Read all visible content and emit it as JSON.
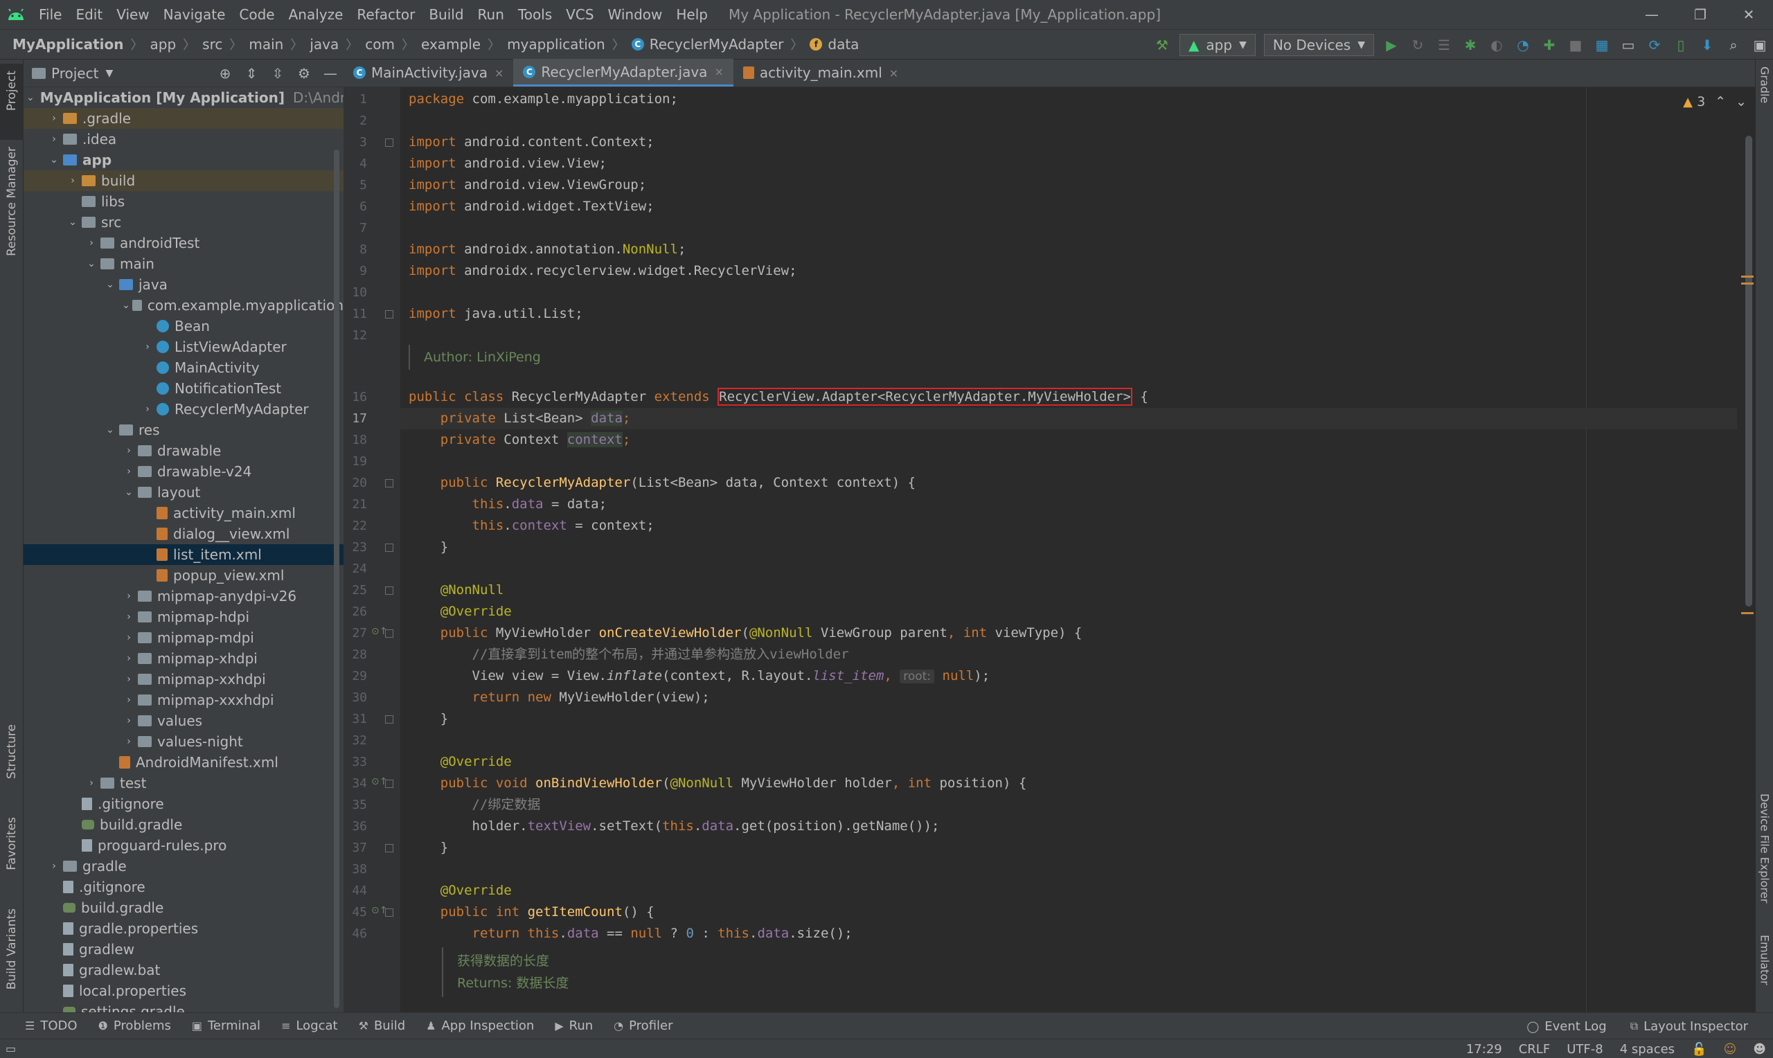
{
  "window": {
    "menu": [
      "File",
      "Edit",
      "View",
      "Navigate",
      "Code",
      "Analyze",
      "Refactor",
      "Build",
      "Run",
      "Tools",
      "VCS",
      "Window",
      "Help"
    ],
    "title": "My Application - RecyclerMyAdapter.java [My_Application.app]",
    "min": "—",
    "max": "❐",
    "close": "✕"
  },
  "nav": {
    "crumbs": [
      "MyApplication",
      "app",
      "src",
      "main",
      "java",
      "com",
      "example",
      "myapplication",
      "RecyclerMyAdapter",
      "data"
    ],
    "run_config": "app",
    "device": "No Devices"
  },
  "left_stripe": {
    "project": "Project",
    "resource_manager": "Resource Manager",
    "structure": "Structure",
    "favorites": "Favorites",
    "build_variants": "Build Variants"
  },
  "right_stripe": {
    "gradle": "Gradle",
    "device_file_explorer": "Device File Explorer",
    "emulator": "Emulator"
  },
  "project_panel": {
    "title": "Project",
    "tree": [
      {
        "depth": 0,
        "arrow": "down",
        "icon": "folder-blue",
        "label": "MyApplication [My Application]",
        "dim": "D:\\AndroidDe",
        "bold": true
      },
      {
        "depth": 1,
        "arrow": "right",
        "icon": "folder-orange",
        "label": ".gradle",
        "state": "excluded"
      },
      {
        "depth": 1,
        "arrow": "right",
        "icon": "folder",
        "label": ".idea"
      },
      {
        "depth": 1,
        "arrow": "down",
        "icon": "folder-blue",
        "label": "app",
        "bold": true
      },
      {
        "depth": 2,
        "arrow": "right",
        "icon": "folder-orange",
        "label": "build",
        "state": "excluded"
      },
      {
        "depth": 2,
        "arrow": "none",
        "icon": "folder",
        "label": "libs"
      },
      {
        "depth": 2,
        "arrow": "down",
        "icon": "folder",
        "label": "src"
      },
      {
        "depth": 3,
        "arrow": "right",
        "icon": "folder",
        "label": "androidTest"
      },
      {
        "depth": 3,
        "arrow": "down",
        "icon": "folder",
        "label": "main"
      },
      {
        "depth": 4,
        "arrow": "down",
        "icon": "folder-blue",
        "label": "java"
      },
      {
        "depth": 5,
        "arrow": "down",
        "icon": "folder",
        "label": "com.example.myapplication"
      },
      {
        "depth": 6,
        "arrow": "none",
        "icon": "class",
        "label": "Bean"
      },
      {
        "depth": 6,
        "arrow": "right",
        "icon": "class",
        "label": "ListViewAdapter"
      },
      {
        "depth": 6,
        "arrow": "none",
        "icon": "class",
        "label": "MainActivity"
      },
      {
        "depth": 6,
        "arrow": "none",
        "icon": "class",
        "label": "NotificationTest"
      },
      {
        "depth": 6,
        "arrow": "right",
        "icon": "class",
        "label": "RecyclerMyAdapter"
      },
      {
        "depth": 4,
        "arrow": "down",
        "icon": "folder",
        "label": "res"
      },
      {
        "depth": 5,
        "arrow": "right",
        "icon": "folder",
        "label": "drawable"
      },
      {
        "depth": 5,
        "arrow": "right",
        "icon": "folder",
        "label": "drawable-v24"
      },
      {
        "depth": 5,
        "arrow": "down",
        "icon": "folder",
        "label": "layout"
      },
      {
        "depth": 6,
        "arrow": "none",
        "icon": "xml",
        "label": "activity_main.xml"
      },
      {
        "depth": 6,
        "arrow": "none",
        "icon": "xml",
        "label": "dialog__view.xml"
      },
      {
        "depth": 6,
        "arrow": "none",
        "icon": "xml",
        "label": "list_item.xml",
        "state": "selected"
      },
      {
        "depth": 6,
        "arrow": "none",
        "icon": "xml",
        "label": "popup_view.xml"
      },
      {
        "depth": 5,
        "arrow": "right",
        "icon": "folder",
        "label": "mipmap-anydpi-v26"
      },
      {
        "depth": 5,
        "arrow": "right",
        "icon": "folder",
        "label": "mipmap-hdpi"
      },
      {
        "depth": 5,
        "arrow": "right",
        "icon": "folder",
        "label": "mipmap-mdpi"
      },
      {
        "depth": 5,
        "arrow": "right",
        "icon": "folder",
        "label": "mipmap-xhdpi"
      },
      {
        "depth": 5,
        "arrow": "right",
        "icon": "folder",
        "label": "mipmap-xxhdpi"
      },
      {
        "depth": 5,
        "arrow": "right",
        "icon": "folder",
        "label": "mipmap-xxxhdpi"
      },
      {
        "depth": 5,
        "arrow": "right",
        "icon": "folder",
        "label": "values"
      },
      {
        "depth": 5,
        "arrow": "right",
        "icon": "folder",
        "label": "values-night"
      },
      {
        "depth": 4,
        "arrow": "none",
        "icon": "xml",
        "label": "AndroidManifest.xml"
      },
      {
        "depth": 3,
        "arrow": "right",
        "icon": "folder",
        "label": "test"
      },
      {
        "depth": 2,
        "arrow": "none",
        "icon": "file",
        "label": ".gitignore"
      },
      {
        "depth": 2,
        "arrow": "none",
        "icon": "gradle",
        "label": "build.gradle"
      },
      {
        "depth": 2,
        "arrow": "none",
        "icon": "file",
        "label": "proguard-rules.pro"
      },
      {
        "depth": 1,
        "arrow": "right",
        "icon": "folder",
        "label": "gradle"
      },
      {
        "depth": 1,
        "arrow": "none",
        "icon": "file",
        "label": ".gitignore"
      },
      {
        "depth": 1,
        "arrow": "none",
        "icon": "gradle",
        "label": "build.gradle"
      },
      {
        "depth": 1,
        "arrow": "none",
        "icon": "file",
        "label": "gradle.properties"
      },
      {
        "depth": 1,
        "arrow": "none",
        "icon": "file",
        "label": "gradlew"
      },
      {
        "depth": 1,
        "arrow": "none",
        "icon": "file",
        "label": "gradlew.bat"
      },
      {
        "depth": 1,
        "arrow": "none",
        "icon": "file",
        "label": "local.properties"
      },
      {
        "depth": 1,
        "arrow": "none",
        "icon": "gradle",
        "label": "settings.gradle"
      }
    ]
  },
  "editor": {
    "tabs": [
      {
        "label": "MainActivity.java",
        "icon": "class",
        "active": false
      },
      {
        "label": "RecyclerMyAdapter.java",
        "icon": "class",
        "active": true
      },
      {
        "label": "activity_main.xml",
        "icon": "xml",
        "active": false
      }
    ],
    "warnings": "3",
    "current_line": "17",
    "lines": [
      {
        "n": "1",
        "segs": [
          [
            "kw",
            "package "
          ],
          [
            "",
            "com.example.myapplication;"
          ]
        ]
      },
      {
        "n": "2",
        "segs": []
      },
      {
        "n": "3",
        "segs": [
          [
            "kw",
            "import "
          ],
          [
            "",
            "android.content.Context;"
          ]
        ],
        "fold": true
      },
      {
        "n": "4",
        "segs": [
          [
            "kw",
            "import "
          ],
          [
            "",
            "android.view.View;"
          ]
        ]
      },
      {
        "n": "5",
        "segs": [
          [
            "kw",
            "import "
          ],
          [
            "",
            "android.view.ViewGroup;"
          ]
        ]
      },
      {
        "n": "6",
        "segs": [
          [
            "kw",
            "import "
          ],
          [
            "",
            "android.widget.TextView;"
          ]
        ]
      },
      {
        "n": "7",
        "segs": []
      },
      {
        "n": "8",
        "segs": [
          [
            "kw",
            "import "
          ],
          [
            "",
            "androidx.annotation."
          ],
          [
            "ann",
            "NonNull"
          ],
          [
            "",
            ";"
          ]
        ]
      },
      {
        "n": "9",
        "segs": [
          [
            "kw",
            "import "
          ],
          [
            "",
            "androidx.recyclerview.widget.RecyclerView;"
          ]
        ]
      },
      {
        "n": "10",
        "segs": []
      },
      {
        "n": "11",
        "segs": [
          [
            "kw",
            "import "
          ],
          [
            "",
            "java.util.List;"
          ]
        ],
        "fold": true
      },
      {
        "n": "12",
        "segs": []
      },
      {
        "n": "16",
        "segs": [
          [
            "kw",
            "public class "
          ],
          [
            "",
            "RecyclerMyAdapter "
          ],
          [
            "kw",
            "extends "
          ],
          [
            "redbox",
            "RecyclerView.Adapter<RecyclerMyAdapter.MyViewHolder>"
          ],
          [
            "",
            " {"
          ]
        ]
      },
      {
        "n": "17",
        "segs": [
          [
            "",
            "    "
          ],
          [
            "kw",
            "private "
          ],
          [
            "",
            "List<Bean> "
          ],
          [
            "fld hl",
            "data"
          ],
          [
            "kw",
            ";"
          ]
        ]
      },
      {
        "n": "18",
        "segs": [
          [
            "",
            "    "
          ],
          [
            "kw",
            "private "
          ],
          [
            "",
            "Context "
          ],
          [
            "fld hl",
            "context"
          ],
          [
            "kw",
            ";"
          ]
        ]
      },
      {
        "n": "19",
        "segs": []
      },
      {
        "n": "20",
        "segs": [
          [
            "",
            "    "
          ],
          [
            "kw",
            "public "
          ],
          [
            "fn",
            "RecyclerMyAdapter"
          ],
          [
            "",
            "(List<Bean> data, Context context) {"
          ]
        ],
        "fold": true
      },
      {
        "n": "21",
        "segs": [
          [
            "",
            "        "
          ],
          [
            "kw",
            "this"
          ],
          [
            "",
            ".",
            ""
          ],
          [
            "fld",
            "data"
          ],
          [
            "",
            " = data;"
          ]
        ]
      },
      {
        "n": "22",
        "segs": [
          [
            "",
            "        "
          ],
          [
            "kw",
            "this"
          ],
          [
            "",
            "."
          ],
          [
            "fld",
            "context"
          ],
          [
            "",
            " = context;"
          ]
        ]
      },
      {
        "n": "23",
        "segs": [
          [
            "",
            "    }"
          ]
        ],
        "fold": true
      },
      {
        "n": "24",
        "segs": []
      },
      {
        "n": "25",
        "segs": [
          [
            "",
            "    "
          ],
          [
            "ann",
            "@NonNull"
          ]
        ],
        "fold": true
      },
      {
        "n": "26",
        "segs": [
          [
            "",
            "    "
          ],
          [
            "ann",
            "@Override"
          ]
        ]
      },
      {
        "n": "27",
        "segs": [
          [
            "",
            "    "
          ],
          [
            "kw",
            "public "
          ],
          [
            "",
            "MyViewHolder "
          ],
          [
            "fn",
            "onCreateViewHolder"
          ],
          [
            "",
            "("
          ],
          [
            "ann",
            "@NonNull "
          ],
          [
            "",
            "ViewGroup parent"
          ],
          [
            "kw",
            ", int "
          ],
          [
            "",
            "viewType) {"
          ]
        ],
        "fold": true,
        "mark": true
      },
      {
        "n": "28",
        "segs": [
          [
            "",
            "        "
          ],
          [
            "cmt",
            "//直接拿到item的整个布局，并通过单参构造放入viewHolder"
          ]
        ]
      },
      {
        "n": "29",
        "segs": [
          [
            "",
            "        View view = View."
          ],
          [
            "ital",
            "inflate"
          ],
          [
            "",
            "(context, R.layout."
          ],
          [
            "fld ital",
            "list_item"
          ],
          [
            "kw",
            ", "
          ],
          [
            "hint",
            "root:"
          ],
          [
            "",
            " "
          ],
          [
            "kw",
            "null"
          ],
          [
            "",
            ");"
          ]
        ]
      },
      {
        "n": "30",
        "segs": [
          [
            "",
            "        "
          ],
          [
            "kw",
            "return new "
          ],
          [
            "",
            "MyViewHolder(view);"
          ]
        ]
      },
      {
        "n": "31",
        "segs": [
          [
            "",
            "    }"
          ]
        ],
        "fold": true
      },
      {
        "n": "32",
        "segs": []
      },
      {
        "n": "33",
        "segs": [
          [
            "",
            "    "
          ],
          [
            "ann",
            "@Override"
          ]
        ]
      },
      {
        "n": "34",
        "segs": [
          [
            "",
            "    "
          ],
          [
            "kw",
            "public void "
          ],
          [
            "fn",
            "onBindViewHolder"
          ],
          [
            "",
            "("
          ],
          [
            "ann",
            "@NonNull "
          ],
          [
            "",
            "MyViewHolder holder"
          ],
          [
            "kw",
            ", int "
          ],
          [
            "",
            "position) {"
          ]
        ],
        "fold": true,
        "mark": true
      },
      {
        "n": "35",
        "segs": [
          [
            "",
            "        "
          ],
          [
            "cmt",
            "//绑定数据"
          ]
        ]
      },
      {
        "n": "36",
        "segs": [
          [
            "",
            "        holder."
          ],
          [
            "fld",
            "textView"
          ],
          [
            "",
            ".setText("
          ],
          [
            "kw",
            "this"
          ],
          [
            "",
            "."
          ],
          [
            "fld",
            "data"
          ],
          [
            "",
            ".get(position).getName());"
          ]
        ]
      },
      {
        "n": "37",
        "segs": [
          [
            "",
            "    }"
          ]
        ],
        "fold": true
      },
      {
        "n": "38",
        "segs": []
      },
      {
        "n": "44",
        "segs": [
          [
            "",
            "    "
          ],
          [
            "ann",
            "@Override"
          ]
        ]
      },
      {
        "n": "45",
        "segs": [
          [
            "",
            "    "
          ],
          [
            "kw",
            "public int "
          ],
          [
            "fn",
            "getItemCount"
          ],
          [
            "",
            "() {"
          ]
        ],
        "fold": true,
        "mark": true
      },
      {
        "n": "46",
        "segs": [
          [
            "",
            "        "
          ],
          [
            "kw",
            "return this"
          ],
          [
            "",
            "."
          ],
          [
            "fld",
            "data "
          ],
          [
            "",
            ""
          ],
          [
            "",
            "== "
          ],
          [
            "kw",
            "null "
          ],
          [
            "",
            "? "
          ],
          [
            "num",
            "0 "
          ],
          [
            "",
            ": "
          ],
          [
            "kw",
            "this"
          ],
          [
            "",
            "."
          ],
          [
            "fld",
            "data"
          ],
          [
            "",
            ".size();"
          ]
        ]
      }
    ],
    "doc_author": "Author: LinXiPeng",
    "doc_len_title": "获得数据的长度",
    "doc_len_returns": "Returns: 数据长度"
  },
  "bottom_tabs": [
    {
      "label": "TODO",
      "icon": "☰"
    },
    {
      "label": "Problems",
      "icon": "❶"
    },
    {
      "label": "Terminal",
      "icon": "▣"
    },
    {
      "label": "Logcat",
      "icon": "≡"
    },
    {
      "label": "Build",
      "icon": "⚒"
    },
    {
      "label": "App Inspection",
      "icon": "♟"
    },
    {
      "label": "Run",
      "icon": "▶"
    },
    {
      "label": "Profiler",
      "icon": "◔"
    }
  ],
  "bottom_right_tabs": [
    {
      "label": "Event Log",
      "icon": "◯"
    },
    {
      "label": "Layout Inspector",
      "icon": "⧉"
    }
  ],
  "status": {
    "position": "17:29",
    "line_sep": "CRLF",
    "encoding": "UTF-8",
    "indent": "4 spaces"
  },
  "colors": {
    "accent": "#4a88c7",
    "keyword": "#cc7832",
    "annotation": "#bbb529",
    "field": "#9876aa",
    "function": "#ffc66d",
    "selection": "#0d293e"
  }
}
